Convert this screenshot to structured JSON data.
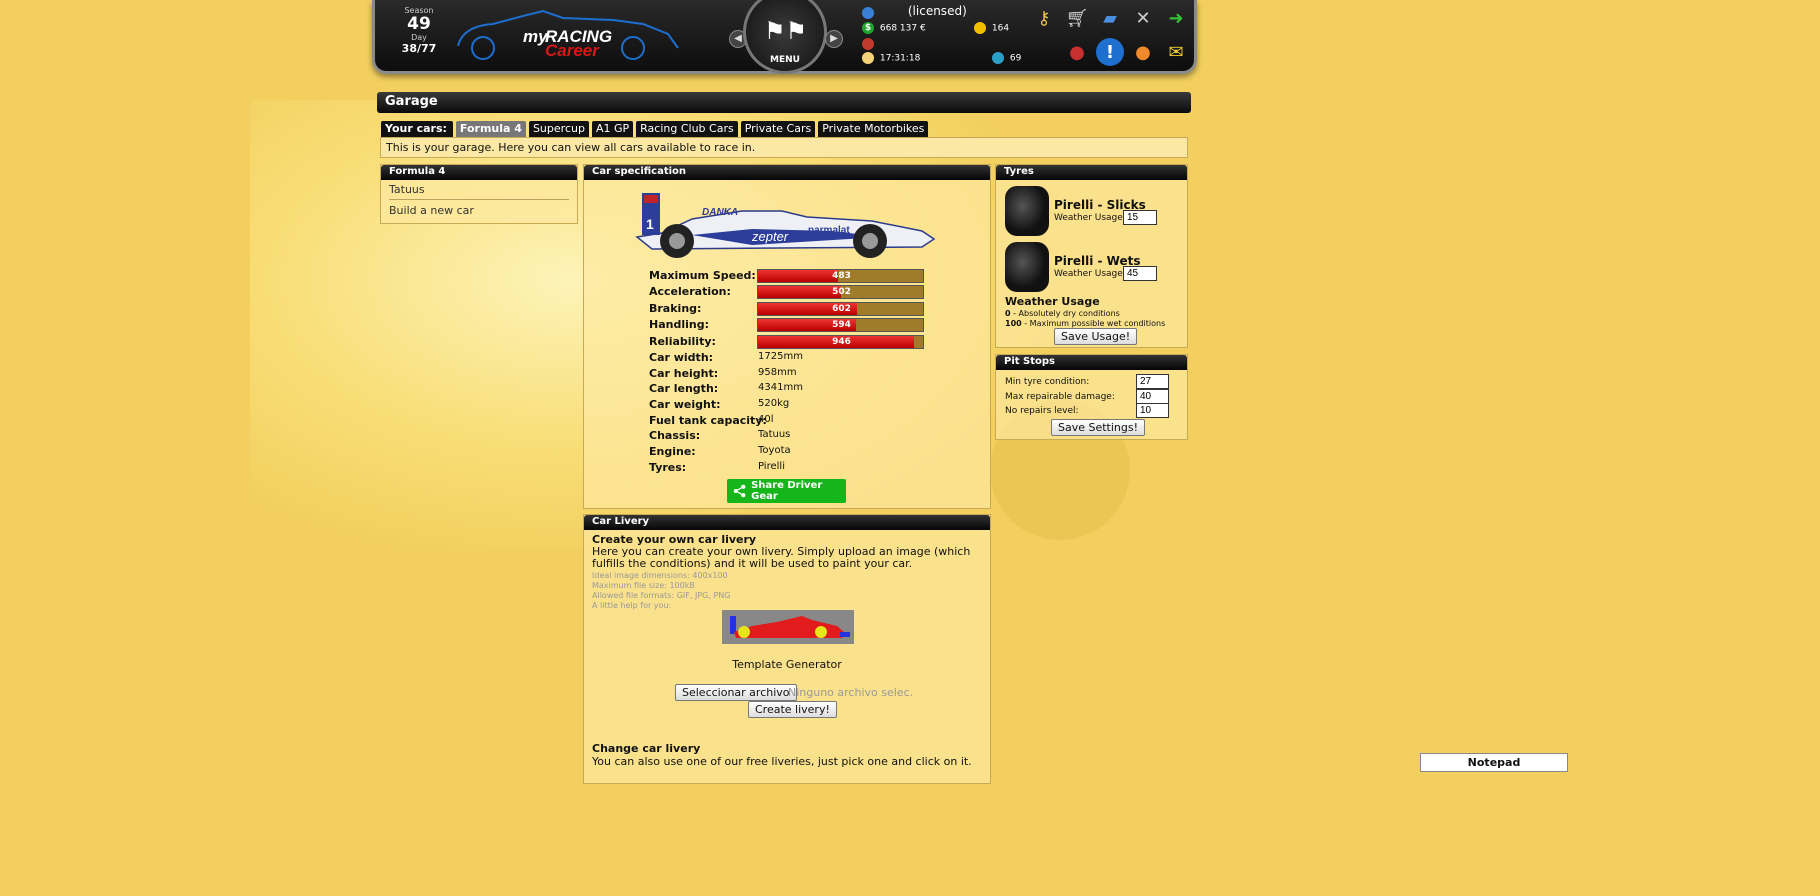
{
  "header": {
    "season_label": "Season",
    "season_value": "49",
    "day_label": "Day",
    "day_value": "38/77",
    "logo_text": "myRACING Career",
    "menu_label": "MENU",
    "licensed": "(licensed)",
    "money": "668 137 €",
    "time": "17:31:18",
    "coins": "164",
    "points": "69"
  },
  "page": {
    "title": "Garage",
    "tabs_label": "Your cars:",
    "tabs": [
      "Formula 4",
      "Supercup",
      "A1 GP",
      "Racing Club Cars",
      "Private Cars",
      "Private Motorbikes"
    ],
    "info": "This is your garage. Here you can view all cars available to race in."
  },
  "formula_panel": {
    "title": "Formula 4",
    "items": [
      "Tatuus",
      "Build a new car"
    ]
  },
  "car_spec": {
    "title": "Car specification",
    "car_brands": [
      "DANKA",
      "zepter",
      "parmalat",
      "1"
    ],
    "bars": [
      {
        "label": "Maximum Speed:",
        "value": "483",
        "fill": 0.483
      },
      {
        "label": "Acceleration:",
        "value": "502",
        "fill": 0.502
      },
      {
        "label": "Braking:",
        "value": "602",
        "fill": 0.602
      },
      {
        "label": "Handling:",
        "value": "594",
        "fill": 0.594
      },
      {
        "label": "Reliability:",
        "value": "946",
        "fill": 0.946
      }
    ],
    "rows": [
      {
        "label": "Car width:",
        "value": "1725mm"
      },
      {
        "label": "Car height:",
        "value": "958mm"
      },
      {
        "label": "Car length:",
        "value": "4341mm"
      },
      {
        "label": "Car weight:",
        "value": "520kg"
      },
      {
        "label": "Fuel tank capacity:",
        "value": "40l"
      },
      {
        "label": "Chassis:",
        "value": "Tatuus"
      },
      {
        "label": "Engine:",
        "value": "Toyota"
      },
      {
        "label": "Tyres:",
        "value": "Pirelli"
      }
    ],
    "share_label": "Share Driver Gear"
  },
  "tyres": {
    "title": "Tyres",
    "items": [
      {
        "name": "Pirelli - Slicks",
        "usage_label": "Weather Usage:",
        "usage_value": "15"
      },
      {
        "name": "Pirelli - Wets",
        "usage_label": "Weather Usage:",
        "usage_value": "45"
      }
    ],
    "weather_title": "Weather Usage",
    "dry_bold": "0",
    "dry_text": " - Absolutely dry conditions",
    "wet_bold": "100",
    "wet_text": " - Maximum possible wet conditions",
    "save_label": "Save Usage!"
  },
  "pitstops": {
    "title": "Pit Stops",
    "rows": [
      {
        "label": "Min tyre condition:",
        "value": "27"
      },
      {
        "label": "Max repairable damage:",
        "value": "40"
      },
      {
        "label": "No repairs level:",
        "value": "10"
      }
    ],
    "save_label": "Save Settings!"
  },
  "livery": {
    "title": "Car Livery",
    "create_title": "Create your own car livery",
    "create_text": "Here you can create your own livery. Simply upload an image (which fulfills the conditions) and it will be used to paint your car.",
    "dims": "Ideal image dimensions: 400x100",
    "max_size": "Maximum file size: 100kB",
    "formats": "Allowed file formats: GIF, JPG, PNG",
    "help": "A little help for you:",
    "template_label": "Template Generator",
    "file_button": "Seleccionar archivo",
    "file_status": "Ninguno archivo selec.",
    "create_button": "Create livery!",
    "change_title": "Change car livery",
    "change_text": "You can also use one of our free liveries, just pick one and click on it."
  },
  "notepad": "Notepad"
}
